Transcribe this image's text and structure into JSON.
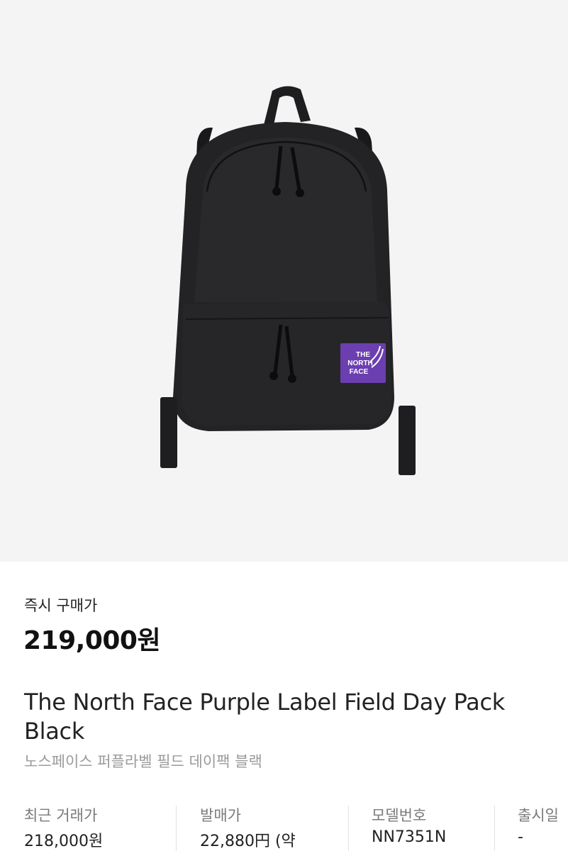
{
  "product_image": {
    "alt": "The North Face Purple Label Field Day Pack Black",
    "logo_line1": "THE",
    "logo_line2": "NORTH",
    "logo_line3": "FACE",
    "logo_color": "#6b3fb0"
  },
  "price_section": {
    "label": "즉시 구매가",
    "price": "219,000원"
  },
  "product": {
    "title": "The North Face Purple Label Field Day Pack Black",
    "subtitle": "노스페이스 퍼플라벨 필드 데이팩 블랙"
  },
  "specs": [
    {
      "label": "최근 거래가",
      "value": "218,000원"
    },
    {
      "label": "발매가",
      "value": "22,880円 (약"
    },
    {
      "label": "모델번호",
      "value": "NN7351N"
    },
    {
      "label": "출시일",
      "value": "-"
    }
  ]
}
